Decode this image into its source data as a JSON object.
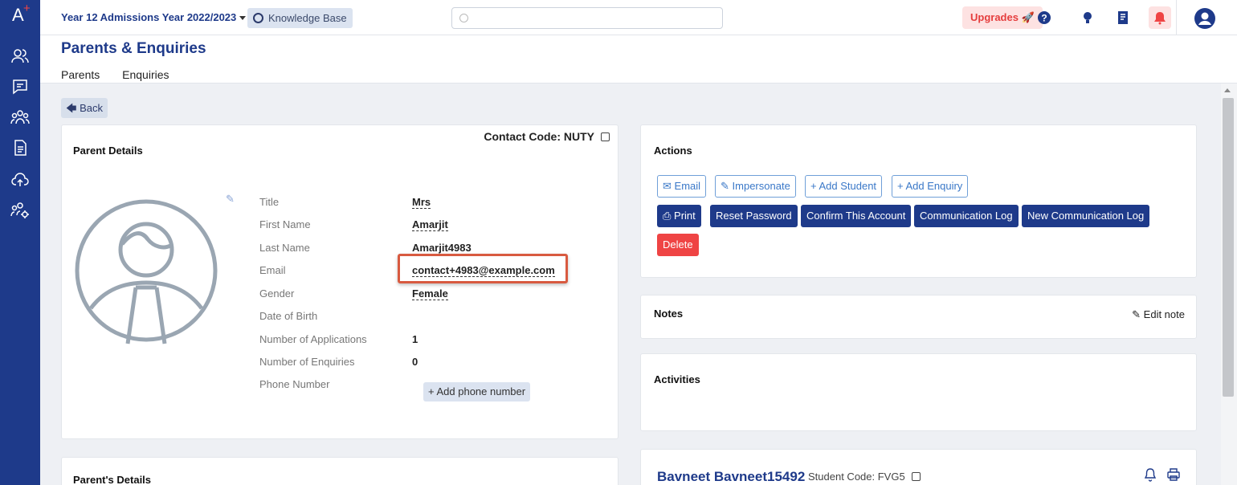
{
  "app": {
    "logo_text": "A"
  },
  "topbar": {
    "year_label": "Year 12 Admissions Year 2022/2023",
    "knowledge_base": "Knowledge Base",
    "search_placeholder": "",
    "upgrades": "Upgrades"
  },
  "sidebar": {
    "icons": [
      "contacts-icon",
      "messages-icon",
      "people-icon",
      "document-icon",
      "cloud-upload-icon",
      "user-settings-icon"
    ]
  },
  "page": {
    "title": "Parents & Enquiries",
    "tabs": [
      "Parents",
      "Enquiries"
    ],
    "back": "Back"
  },
  "parent_details": {
    "title": "Parent Details",
    "contact_code": "Contact Code: NUTY",
    "fields": [
      {
        "label": "Title",
        "value": "Mrs"
      },
      {
        "label": "First Name",
        "value": "Amarjit"
      },
      {
        "label": "Last Name",
        "value": "Amarjit4983"
      },
      {
        "label": "Email",
        "value": "contact+4983@example.com"
      },
      {
        "label": "Gender",
        "value": "Female"
      },
      {
        "label": "Date of Birth",
        "value": ""
      },
      {
        "label": "Number of Applications",
        "value": "1"
      },
      {
        "label": "Number of Enquiries",
        "value": "0"
      },
      {
        "label": "Phone Number",
        "value": ""
      }
    ],
    "add_phone": "+ Add phone number"
  },
  "parents_details_card": {
    "title": "Parent's Details"
  },
  "actions": {
    "title": "Actions",
    "email": "Email",
    "impersonate": "Impersonate",
    "add_student": "+ Add Student",
    "add_enquiry": "+ Add Enquiry",
    "print": "Print",
    "reset_password": "Reset Password",
    "confirm_account": "Confirm This Account",
    "communication_log": "Communication Log",
    "new_communication_log": "New Communication Log",
    "delete": "Delete"
  },
  "notes": {
    "title": "Notes",
    "edit": "Edit note"
  },
  "activities": {
    "title": "Activities"
  },
  "student": {
    "name": "Bavneet Bavneet15492",
    "code": "Student Code: FVG5"
  }
}
